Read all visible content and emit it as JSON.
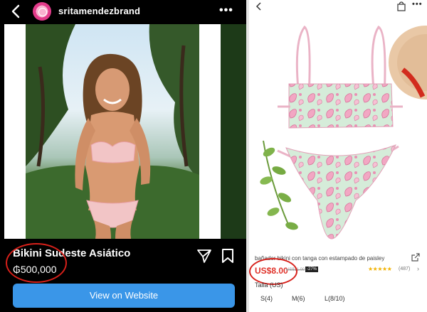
{
  "instagram": {
    "username": "sritamendezbrand",
    "more_label": "•••",
    "product_name": "Bikini Sudeste Asiático",
    "price": "₲500,000",
    "cta_label": "View on Website"
  },
  "shop": {
    "more_label": "•••",
    "product_title": "bañador bikini con tanga con estampado de paisley",
    "price": "US$8.00",
    "old_price": "US$11.00",
    "discount": "-27%",
    "rating_stars": "★★★★★",
    "rating": 4.5,
    "review_count": "(487)",
    "chevron": "›",
    "size_label": "Talla (US)",
    "sizes": [
      "S(4)",
      "M(6)",
      "L(8/10)"
    ]
  },
  "colors": {
    "cta_blue": "#3a96e8",
    "sale_red": "#e0332b",
    "annotation_red": "#d7201a",
    "star_yellow": "#f2b200"
  }
}
